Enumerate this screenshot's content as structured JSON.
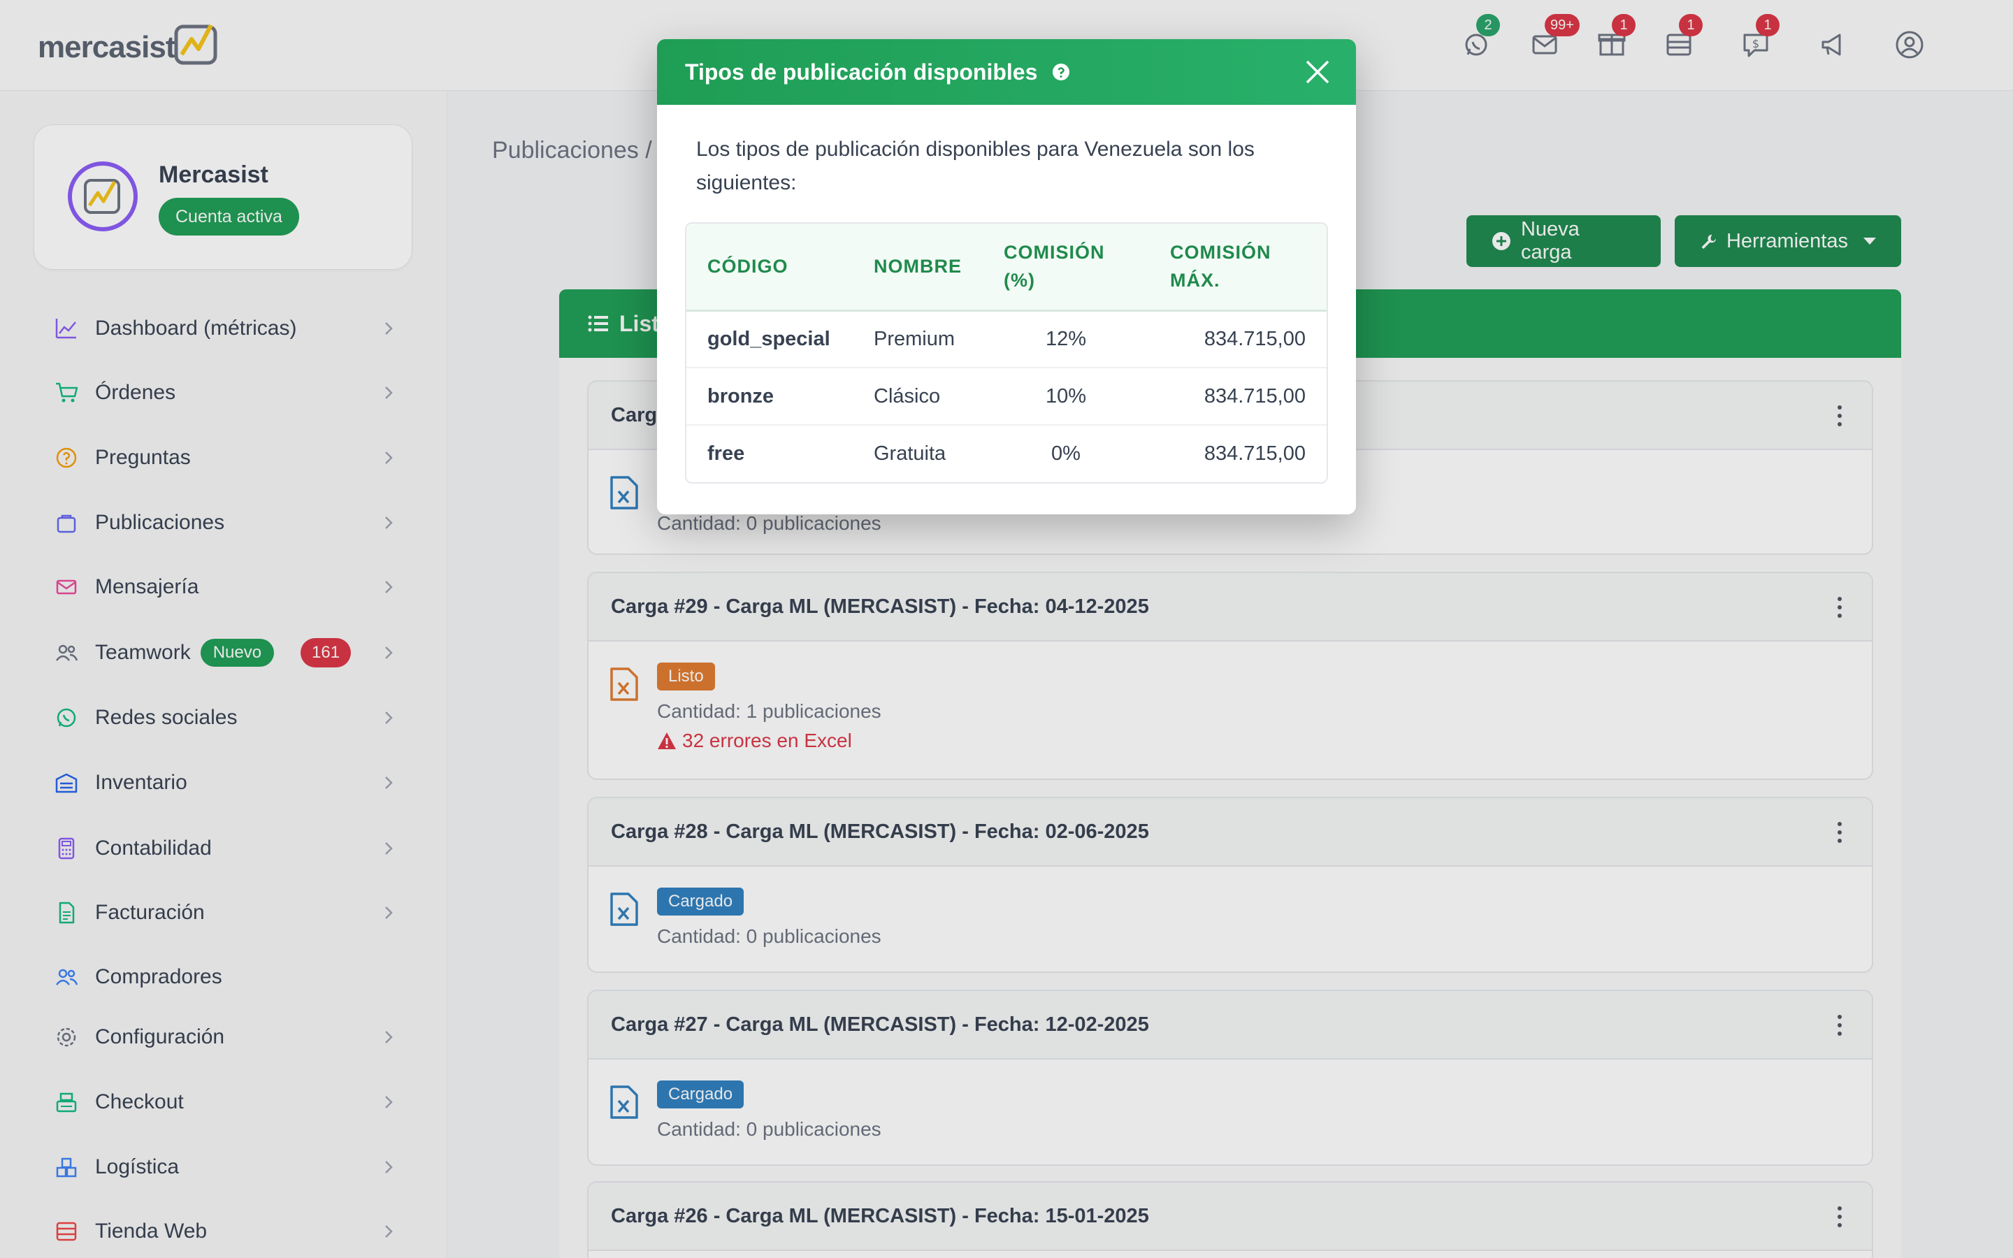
{
  "brand": {
    "name": "mercasist"
  },
  "topbar": {
    "whatsapp_badge": "2",
    "mail_badge": "99+",
    "box_badge": "1",
    "store_badge": "1",
    "money_badge": "1"
  },
  "profile": {
    "name": "Mercasist",
    "status": "Cuenta activa"
  },
  "sidebar": {
    "items": [
      {
        "label": "Dashboard (métricas)"
      },
      {
        "label": "Órdenes"
      },
      {
        "label": "Preguntas"
      },
      {
        "label": "Publicaciones"
      },
      {
        "label": "Mensajería"
      },
      {
        "label": "Teamwork",
        "tag": "Nuevo",
        "count": "161"
      },
      {
        "label": "Redes sociales"
      },
      {
        "label": "Inventario"
      },
      {
        "label": "Contabilidad"
      },
      {
        "label": "Facturación"
      },
      {
        "label": "Compradores"
      },
      {
        "label": "Configuración"
      },
      {
        "label": "Checkout"
      },
      {
        "label": "Logística"
      },
      {
        "label": "Tienda Web"
      }
    ]
  },
  "main": {
    "breadcrumb": "Publicaciones /",
    "new_upload_label": "Nueva carga",
    "tools_label": "Herramientas",
    "list_title": "List",
    "cards": [
      {
        "title": "Carg",
        "status": "",
        "quantity": "Cantidad: 0 publicaciones",
        "errors": ""
      },
      {
        "title": "Carga #29 - Carga ML (MERCASIST) - Fecha: 04-12-2025",
        "status": "Listo",
        "quantity": "Cantidad: 1 publicaciones",
        "errors": "32 errores en Excel"
      },
      {
        "title": "Carga #28 - Carga ML (MERCASIST) - Fecha: 02-06-2025",
        "status": "Cargado",
        "quantity": "Cantidad: 0 publicaciones",
        "errors": ""
      },
      {
        "title": "Carga #27 - Carga ML (MERCASIST) - Fecha: 12-02-2025",
        "status": "Cargado",
        "quantity": "Cantidad: 0 publicaciones",
        "errors": ""
      },
      {
        "title": "Carga #26 - Carga ML (MERCASIST) - Fecha: 15-01-2025",
        "status": "",
        "quantity": "",
        "errors": ""
      }
    ]
  },
  "modal": {
    "title": "Tipos de publicación disponibles",
    "description": "Los tipos de publicación disponibles para Venezuela son los siguientes:",
    "columns": [
      "CÓDIGO",
      "NOMBRE",
      "COMISIÓN (%)",
      "COMISIÓN MÁX."
    ],
    "rows": [
      {
        "code": "gold_special",
        "name": "Premium",
        "commission": "12%",
        "max": "834.715,00"
      },
      {
        "code": "bronze",
        "name": "Clásico",
        "commission": "10%",
        "max": "834.715,00"
      },
      {
        "code": "free",
        "name": "Gratuita",
        "commission": "0%",
        "max": "834.715,00"
      }
    ]
  },
  "colors": {
    "primary": "#1f9d55",
    "danger": "#dc3545",
    "info": "#2f7fbf",
    "warning": "#e07b2f"
  }
}
